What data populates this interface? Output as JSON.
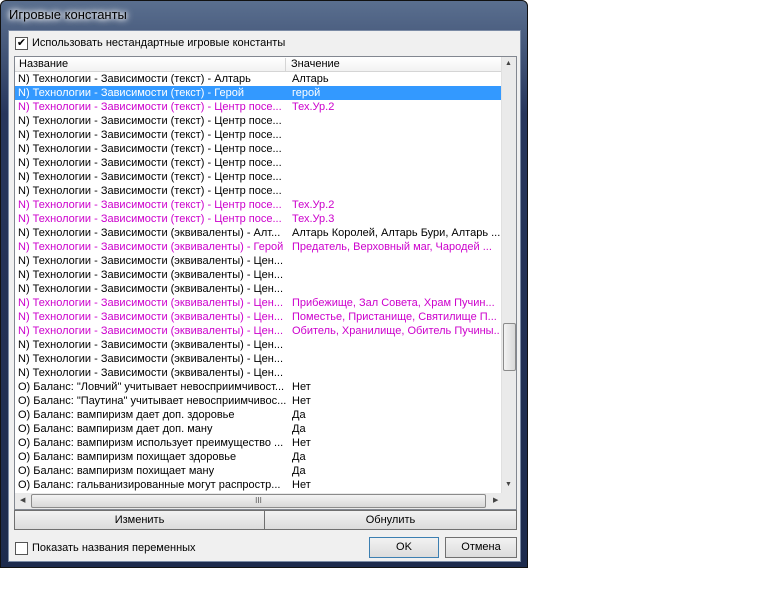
{
  "window": {
    "title": "Игровые константы"
  },
  "use_custom": {
    "label": "Использовать нестандартные игровые константы",
    "checked": true
  },
  "table": {
    "columns": [
      "Название",
      "Значение"
    ],
    "rows": [
      {
        "name": "N) Технологии - Зависимости (текст) - Алтарь",
        "value": "Алтарь",
        "style": "normal"
      },
      {
        "name": "N) Технологии - Зависимости (текст) - Герой",
        "value": "герой",
        "style": "selected"
      },
      {
        "name": "N) Технологии - Зависимости (текст) - Центр посе...",
        "value": "Тех.Ур.2",
        "style": "modified"
      },
      {
        "name": "N) Технологии - Зависимости (текст) - Центр посе...",
        "value": "",
        "style": "normal"
      },
      {
        "name": "N) Технологии - Зависимости (текст) - Центр посе...",
        "value": "",
        "style": "normal"
      },
      {
        "name": "N) Технологии - Зависимости (текст) - Центр посе...",
        "value": "",
        "style": "normal"
      },
      {
        "name": "N) Технологии - Зависимости (текст) - Центр посе...",
        "value": "",
        "style": "normal"
      },
      {
        "name": "N) Технологии - Зависимости (текст) - Центр посе...",
        "value": "",
        "style": "normal"
      },
      {
        "name": "N) Технологии - Зависимости (текст) - Центр посе...",
        "value": "",
        "style": "normal"
      },
      {
        "name": "N) Технологии - Зависимости (текст) - Центр посе...",
        "value": "Тех.Ур.2",
        "style": "modified"
      },
      {
        "name": "N) Технологии - Зависимости (текст) - Центр посе...",
        "value": "Тех.Ур.3",
        "style": "modified"
      },
      {
        "name": "N) Технологии - Зависимости (эквиваленты) - Алт...",
        "value": "Алтарь Королей, Алтарь Бури, Алтарь ...",
        "style": "normal"
      },
      {
        "name": "N) Технологии - Зависимости (эквиваленты) - Герой",
        "value": "Предатель, Верховный маг, Чародей ...",
        "style": "modified"
      },
      {
        "name": "N) Технологии - Зависимости (эквиваленты) - Цен...",
        "value": "",
        "style": "normal"
      },
      {
        "name": "N) Технологии - Зависимости (эквиваленты) - Цен...",
        "value": "",
        "style": "normal"
      },
      {
        "name": "N) Технологии - Зависимости (эквиваленты) - Цен...",
        "value": "",
        "style": "normal"
      },
      {
        "name": "N) Технологии - Зависимости (эквиваленты) - Цен...",
        "value": "Прибежище, Зал Совета, Храм Пучин...",
        "style": "modified"
      },
      {
        "name": "N) Технологии - Зависимости (эквиваленты) - Цен...",
        "value": "Поместье, Пристанище, Святилище П...",
        "style": "modified"
      },
      {
        "name": "N) Технологии - Зависимости (эквиваленты) - Цен...",
        "value": "Обитель, Хранилище, Обитель Пучины...",
        "style": "modified"
      },
      {
        "name": "N) Технологии - Зависимости (эквиваленты) - Цен...",
        "value": "",
        "style": "normal"
      },
      {
        "name": "N) Технологии - Зависимости (эквиваленты) - Цен...",
        "value": "",
        "style": "normal"
      },
      {
        "name": "N) Технологии - Зависимости (эквиваленты) - Цен...",
        "value": "",
        "style": "normal"
      },
      {
        "name": "O) Баланс: \"Ловчий\" учитывает невосприимчивост...",
        "value": "Нет",
        "style": "normal"
      },
      {
        "name": "O) Баланс: \"Паутина\" учитывает невосприимчивос...",
        "value": "Нет",
        "style": "normal"
      },
      {
        "name": "O) Баланс: вампиризм дает доп. здоровье",
        "value": "Да",
        "style": "normal"
      },
      {
        "name": "O) Баланс: вампиризм дает доп. ману",
        "value": "Да",
        "style": "normal"
      },
      {
        "name": "O) Баланс: вампиризм использует преимущество ...",
        "value": "Нет",
        "style": "normal"
      },
      {
        "name": "O) Баланс: вампиризм похищает здоровье",
        "value": "Да",
        "style": "normal"
      },
      {
        "name": "O) Баланс: вампиризм похищает ману",
        "value": "Да",
        "style": "normal"
      },
      {
        "name": "O) Баланс: гальванизированные могут распростр...",
        "value": "Нет",
        "style": "normal"
      }
    ]
  },
  "buttons": {
    "edit": "Изменить",
    "reset": "Обнулить",
    "ok": "OK",
    "cancel": "Отмена"
  },
  "show_var_names": {
    "label": "Показать названия переменных",
    "checked": false
  },
  "scroll": {
    "hthumb_grip": "III"
  }
}
